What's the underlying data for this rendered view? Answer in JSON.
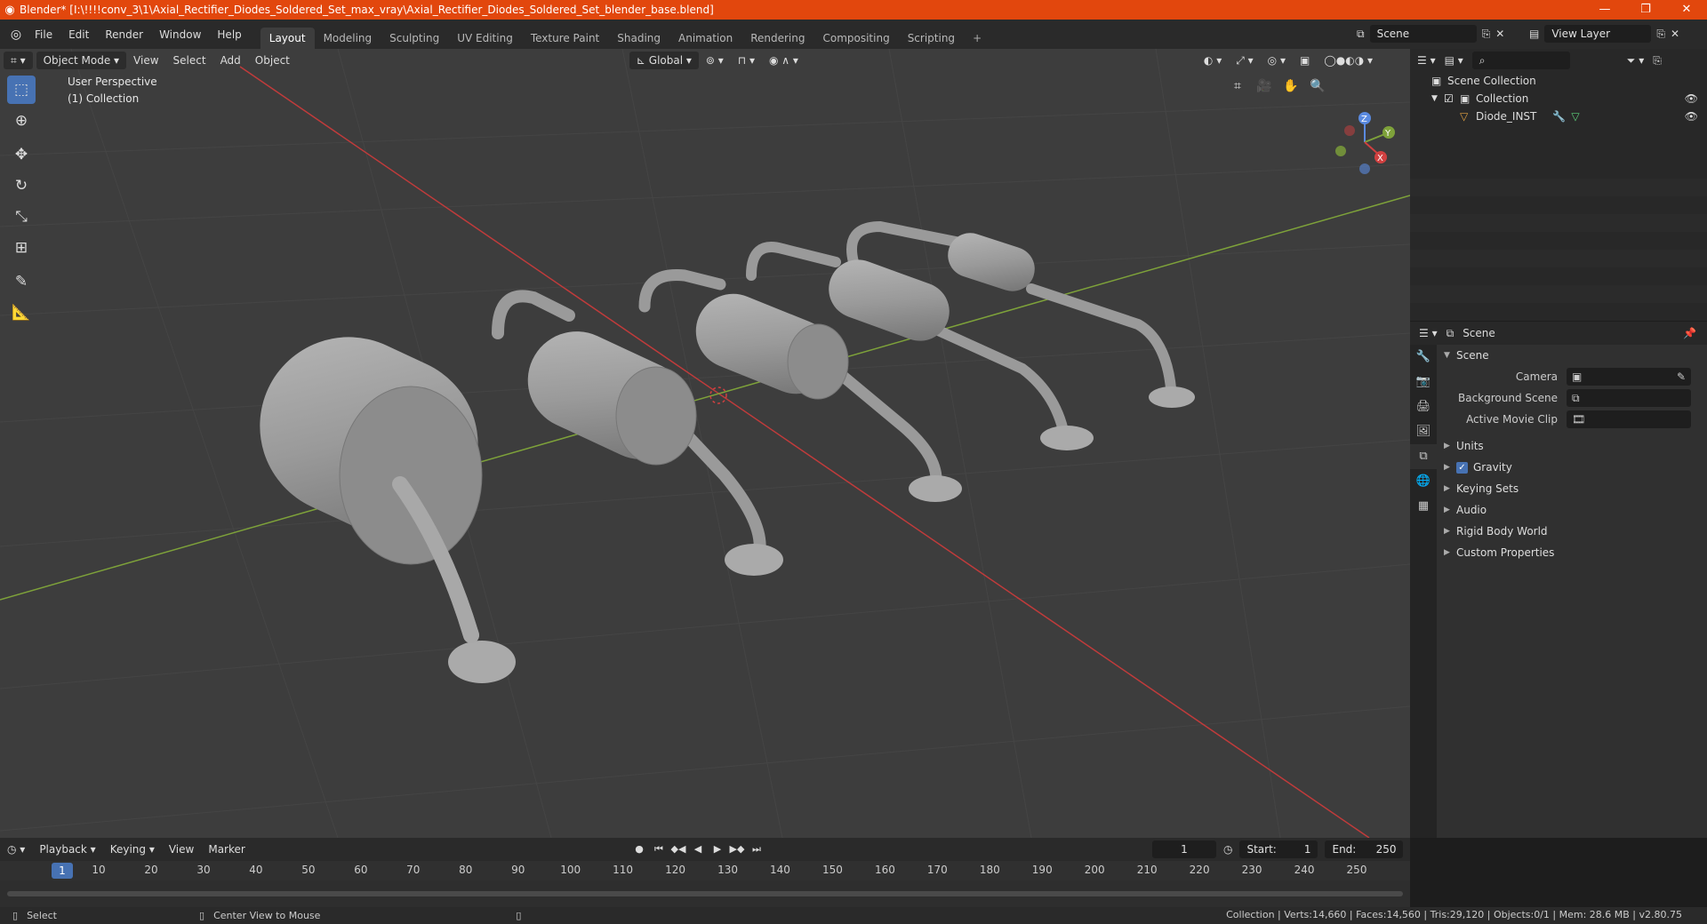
{
  "window": {
    "title": "Blender* [I:\\!!!!conv_3\\1\\Axial_Rectifier_Diodes_Soldered_Set_max_vray\\Axial_Rectifier_Diodes_Soldered_Set_blender_base.blend]",
    "minimize": "—",
    "maximize": "❐",
    "close": "✕"
  },
  "menu": [
    "File",
    "Edit",
    "Render",
    "Window",
    "Help"
  ],
  "workspaces": [
    "Layout",
    "Modeling",
    "Sculpting",
    "UV Editing",
    "Texture Paint",
    "Shading",
    "Animation",
    "Rendering",
    "Compositing",
    "Scripting"
  ],
  "workspace_add": "+",
  "scene_name": "Scene",
  "view_layer": "View Layer",
  "viewport": {
    "mode": "Object Mode",
    "menus": [
      "View",
      "Select",
      "Add",
      "Object"
    ],
    "transform_orientation": "Global",
    "perspective_label": "User Perspective",
    "collection_label": "(1) Collection",
    "gizmo": {
      "x": "X",
      "y": "Y",
      "z": "Z"
    }
  },
  "outliner": {
    "root": "Scene Collection",
    "collection": "Collection",
    "object": "Diode_INST"
  },
  "properties": {
    "tab_title": "Scene",
    "section": "Scene",
    "fields": [
      {
        "label": "Camera",
        "value": ""
      },
      {
        "label": "Background Scene",
        "value": ""
      },
      {
        "label": "Active Movie Clip",
        "value": ""
      }
    ],
    "subsections": [
      "Units",
      "Gravity",
      "Keying Sets",
      "Audio",
      "Rigid Body World",
      "Custom Properties"
    ],
    "gravity_checked": true
  },
  "timeline": {
    "menus": [
      "Playback",
      "Keying",
      "View",
      "Marker"
    ],
    "current_frame": "1",
    "start_label": "Start:",
    "start": "1",
    "end_label": "End:",
    "end": "250",
    "ticks": [
      "1",
      "10",
      "20",
      "30",
      "40",
      "50",
      "60",
      "70",
      "80",
      "90",
      "100",
      "110",
      "120",
      "130",
      "140",
      "150",
      "160",
      "170",
      "180",
      "190",
      "200",
      "210",
      "220",
      "230",
      "240",
      "250"
    ]
  },
  "status": {
    "left_action": "Select",
    "middle_action": "Center View to Mouse",
    "stats": "Collection | Verts:14,660 | Faces:14,560 | Tris:29,120 | Objects:0/1 | Mem: 28.6 MB | v2.80.75"
  },
  "colors": {
    "titlebar": "#e2470d",
    "accent": "#4772b3",
    "viewport_bg": "#3d3d3d",
    "x_axis": "#c03b3b",
    "y_axis": "#7ea23a"
  }
}
